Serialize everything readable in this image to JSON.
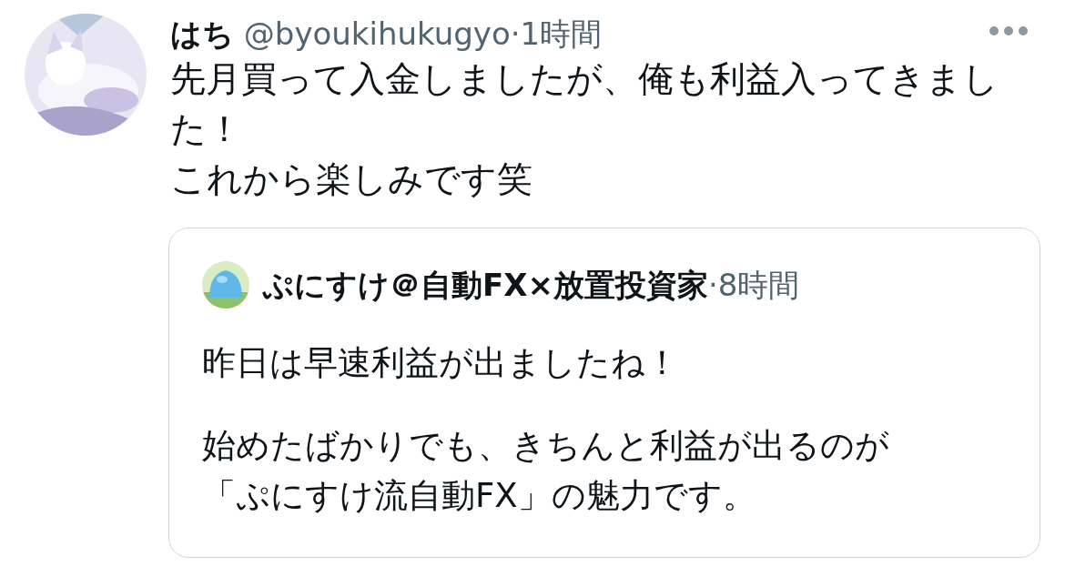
{
  "tweet": {
    "author": {
      "name": "はち",
      "handle": "@byoukihukugyo",
      "time": "·1時間"
    },
    "lines": [
      "先月買って入金しましたが、俺も利益入ってきました！",
      "これから楽しみです笑"
    ],
    "quote": {
      "author": {
        "name": "ぷにすけ＠自動FX×放置投資家",
        "time": "·8時間"
      },
      "paragraphs": [
        [
          "昨日は早速利益が出ましたね！"
        ],
        [
          "始めたばかりでも、きちんと利益が出るのが",
          "「ぷにすけ流自動FX」の魅力です。"
        ]
      ]
    }
  }
}
